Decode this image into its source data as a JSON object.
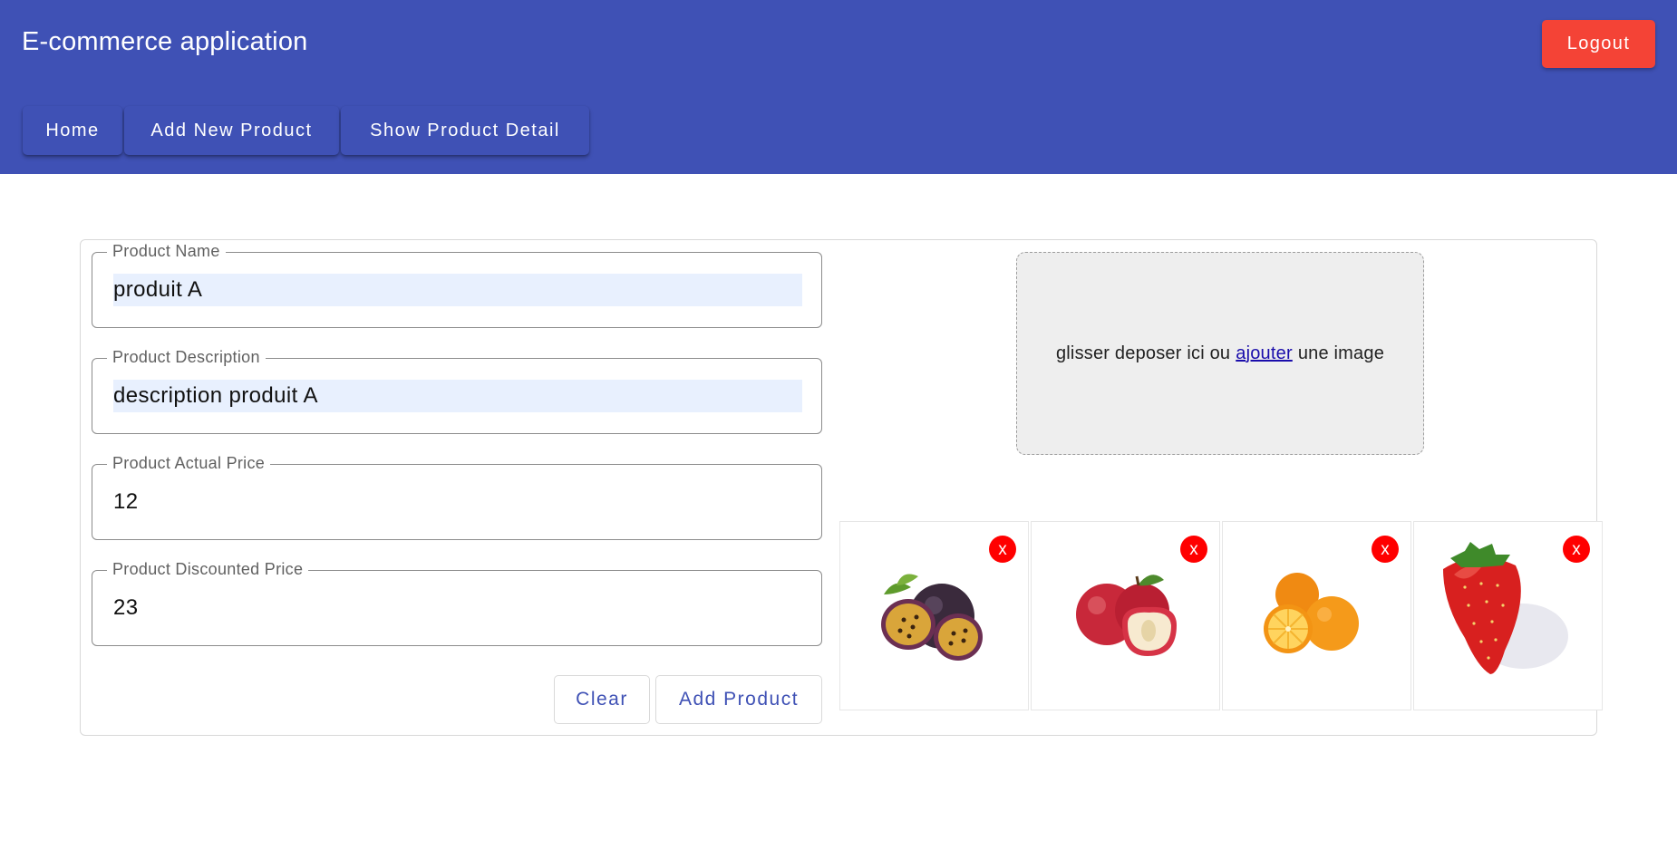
{
  "header": {
    "app_title": "E-commerce application",
    "logout_label": "Logout",
    "nav": [
      {
        "label": "Home"
      },
      {
        "label": "Add New Product"
      },
      {
        "label": "Show Product Detail"
      }
    ]
  },
  "form": {
    "fields": [
      {
        "label": "Product Name",
        "value": "produit A"
      },
      {
        "label": "Product Description",
        "value": "description produit A"
      },
      {
        "label": "Product Actual Price",
        "value": "12"
      },
      {
        "label": "Product Discounted Price",
        "value": "23"
      }
    ],
    "clear_label": "Clear",
    "submit_label": "Add Product"
  },
  "dropzone": {
    "text_before": "glisser deposer ici ou",
    "link_text": "ajouter",
    "text_after": "une image"
  },
  "images": [
    {
      "icon": "passion-fruit-image",
      "remove_label": "x"
    },
    {
      "icon": "apple-image",
      "remove_label": "x"
    },
    {
      "icon": "orange-image",
      "remove_label": "x"
    },
    {
      "icon": "strawberry-image",
      "remove_label": "x"
    }
  ],
  "colors": {
    "primary": "#3f51b5",
    "warn": "#f44336",
    "remove": "#ff0000",
    "autofill": "#e8f0fe"
  }
}
